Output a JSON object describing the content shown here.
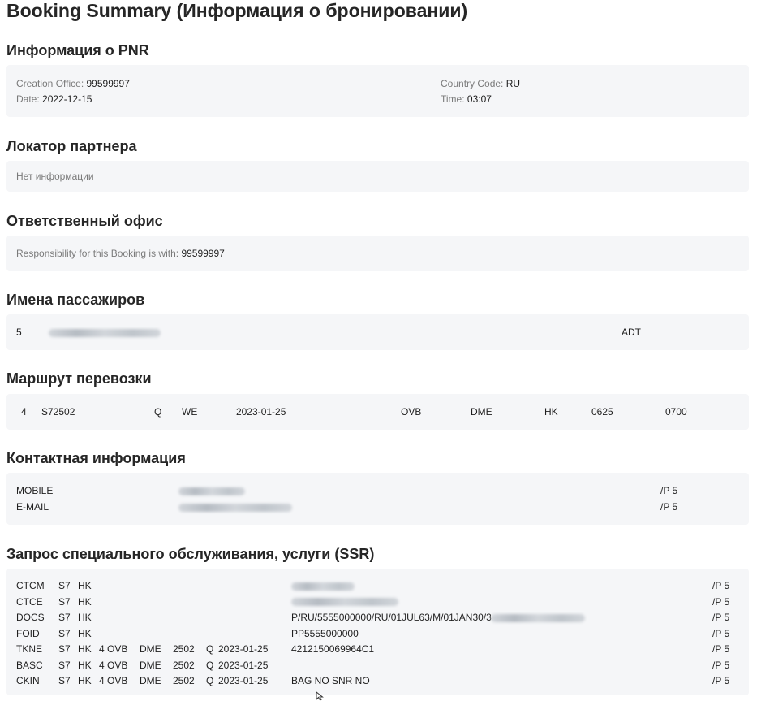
{
  "page_title": "Booking Summary (Информация о бронировании)",
  "pnr": {
    "title": "Информация о PNR",
    "creation_office_label": "Creation Office:",
    "creation_office": "99599997",
    "date_label": "Date:",
    "date": "2022-12-15",
    "country_code_label": "Country Code:",
    "country_code": "RU",
    "time_label": "Time:",
    "time": "03:07"
  },
  "partner_locator": {
    "title": "Локатор партнера",
    "empty_text": "Нет информации"
  },
  "responsible_office": {
    "title": "Ответственный офис",
    "label": "Responsibility for this Booking is with:",
    "value": "99599997"
  },
  "passengers": {
    "title": "Имена пассажиров",
    "rows": [
      {
        "num": "5",
        "type": "ADT"
      }
    ]
  },
  "itinerary": {
    "title": "Маршрут перевозки",
    "segments": [
      {
        "num": "4",
        "flight": "S72502",
        "class": "Q",
        "day": "WE",
        "date": "2023-01-25",
        "from": "OVB",
        "to": "DME",
        "status": "HK",
        "dep": "0625",
        "arr": "0700"
      }
    ]
  },
  "contacts": {
    "title": "Контактная информация",
    "rows": [
      {
        "type": "MOBILE",
        "ref": "/P 5"
      },
      {
        "type": "E-MAIL",
        "ref": "/P 5"
      }
    ]
  },
  "ssr": {
    "title": "Запрос специального обслуживания, услуги (SSR)",
    "rows": [
      {
        "code": "CTCM",
        "airline": "S7",
        "status": "HK",
        "seg": "",
        "from": "",
        "to": "",
        "flight": "",
        "class": "",
        "date": "",
        "text": "",
        "ref": "/P 5"
      },
      {
        "code": "CTCE",
        "airline": "S7",
        "status": "HK",
        "seg": "",
        "from": "",
        "to": "",
        "flight": "",
        "class": "",
        "date": "",
        "text": "",
        "ref": "/P 5"
      },
      {
        "code": "DOCS",
        "airline": "S7",
        "status": "HK",
        "seg": "",
        "from": "",
        "to": "",
        "flight": "",
        "class": "",
        "date": "",
        "text": "P/RU/5555000000/RU/01JUL63/M/01JAN30/3",
        "ref": "/P 5"
      },
      {
        "code": "FOID",
        "airline": "S7",
        "status": "HK",
        "seg": "",
        "from": "",
        "to": "",
        "flight": "",
        "class": "",
        "date": "",
        "text": "PP5555000000",
        "ref": "/P 5"
      },
      {
        "code": "TKNE",
        "airline": "S7",
        "status": "HK",
        "seg": "4",
        "from": "OVB",
        "to": "DME",
        "flight": "2502",
        "class": "Q",
        "date": "2023-01-25",
        "text": "4212150069964C1",
        "ref": "/P 5"
      },
      {
        "code": "BASC",
        "airline": "S7",
        "status": "HK",
        "seg": "4",
        "from": "OVB",
        "to": "DME",
        "flight": "2502",
        "class": "Q",
        "date": "2023-01-25",
        "text": "",
        "ref": "/P 5"
      },
      {
        "code": "CKIN",
        "airline": "S7",
        "status": "HK",
        "seg": "4",
        "from": "OVB",
        "to": "DME",
        "flight": "2502",
        "class": "Q",
        "date": "2023-01-25",
        "text": "BAG NO SNR NO",
        "ref": "/P 5"
      }
    ]
  }
}
